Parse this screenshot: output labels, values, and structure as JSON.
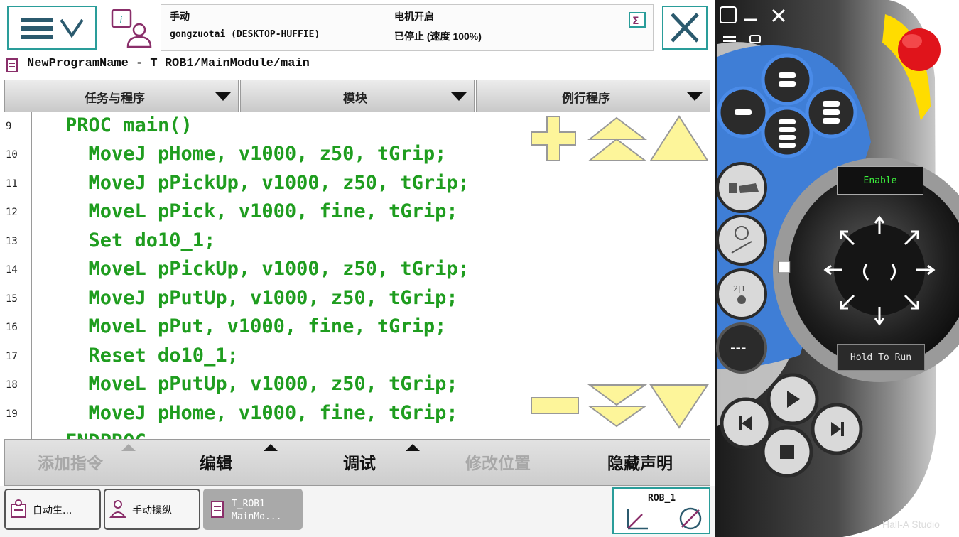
{
  "status": {
    "mode": "手动",
    "controller": "gongzuotai (DESKTOP-HUFFIE)",
    "motor": "电机开启",
    "state": "已停止 (速度 100%)"
  },
  "program_path": "NewProgramName - T_ROB1/MainModule/main",
  "selectors": [
    "任务与程序",
    "模块",
    "例行程序"
  ],
  "code": {
    "line_numbers": [
      "9",
      "10",
      "11",
      "12",
      "13",
      "14",
      "15",
      "16",
      "17",
      "18",
      "19"
    ],
    "lines": [
      "PROC main()",
      "  MoveJ pHome, v1000, z50, tGrip;",
      "  MoveJ pPickUp, v1000, z50, tGrip;",
      "  MoveL pPick, v1000, fine, tGrip;",
      "  Set do10_1;",
      "  MoveL pPickUp, v1000, z50, tGrip;",
      "  MoveJ pPutUp, v1000, z50, tGrip;",
      "  MoveL pPut, v1000, fine, tGrip;",
      "  Reset do10_1;",
      "  MoveL pPutUp, v1000, z50, tGrip;",
      "  MoveJ pHome, v1000, fine, tGrip;",
      "ENDPROC"
    ]
  },
  "menu": [
    {
      "label": "添加指令",
      "enabled": false
    },
    {
      "label": "编辑",
      "enabled": true
    },
    {
      "label": "调试",
      "enabled": true
    },
    {
      "label": "修改位置",
      "enabled": false
    },
    {
      "label": "隐藏声明",
      "enabled": true
    }
  ],
  "taskbar": {
    "items": [
      "自动生...",
      "手动操纵"
    ],
    "active_line1": "T_ROB1",
    "active_line2": "MainMo...",
    "robot": "ROB_1"
  },
  "pendant": {
    "enable_label": "Enable",
    "hold_label": "Hold To Run"
  },
  "watermark": "Hall-A Studio",
  "colors": {
    "accent": "#2a9d9a",
    "code_green": "#1f9d1f",
    "pendant_blue": "#3f7ed6",
    "estop_red": "#e0141b",
    "estop_yellow": "#ffdc00",
    "zoom_yellow": "#fdf59a"
  }
}
